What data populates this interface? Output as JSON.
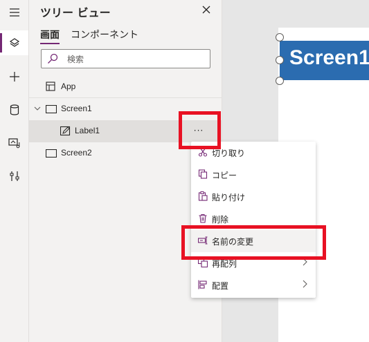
{
  "tree_view": {
    "title": "ツリー ビュー",
    "tabs": [
      {
        "label": "画面"
      },
      {
        "label": "コンポーネント"
      }
    ],
    "search_placeholder": "検索",
    "items": [
      {
        "label": "App"
      },
      {
        "label": "Screen1"
      },
      {
        "label": "Label1"
      },
      {
        "label": "Screen2"
      }
    ],
    "more_button_label": "···"
  },
  "canvas": {
    "label_text": "Screen1",
    "label_color": "#2b6cb0"
  },
  "context_menu": {
    "items": [
      {
        "label": "切り取り",
        "icon": "scissors-icon"
      },
      {
        "label": "コピー",
        "icon": "copy-icon"
      },
      {
        "label": "貼り付け",
        "icon": "paste-icon"
      },
      {
        "label": "削除",
        "icon": "trash-icon"
      },
      {
        "label": "名前の変更",
        "icon": "rename-icon"
      },
      {
        "label": "再配列",
        "icon": "reorder-icon",
        "submenu": true
      },
      {
        "label": "配置",
        "icon": "align-icon",
        "submenu": true
      }
    ]
  },
  "colors": {
    "accent": "#742774",
    "highlight_box": "#e81123"
  }
}
